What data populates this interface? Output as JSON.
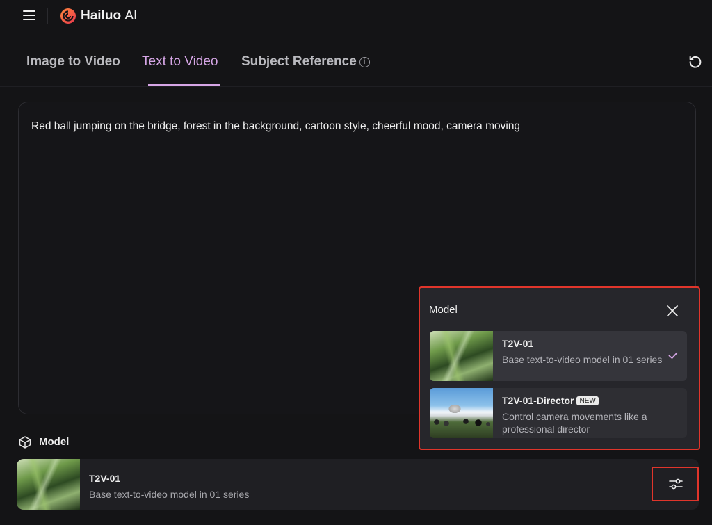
{
  "app": {
    "name": "Hailuo",
    "name_suffix": "AI"
  },
  "icons": {
    "menu": "hamburger-menu-icon",
    "logo": "hailuo-logo-icon",
    "refresh": "refresh-icon",
    "info": "info-icon",
    "model": "cube-icon",
    "settings": "sliders-icon",
    "close": "close-icon",
    "selected": "checkmark-icon"
  },
  "tabs": [
    {
      "label": "Image to Video",
      "active": false
    },
    {
      "label": "Text to Video",
      "active": true
    },
    {
      "label": "Subject Reference",
      "active": false
    }
  ],
  "prompt": {
    "value": "Red ball jumping on the bridge, forest in the background, cartoon style, cheerful mood, camera moving"
  },
  "model_section": {
    "label": "Model",
    "selected": {
      "title": "T2V-01",
      "description": "Base text-to-video model in 01 series"
    }
  },
  "model_popup": {
    "title": "Model",
    "options": [
      {
        "title": "T2V-01",
        "description": "Base text-to-video model in 01 series",
        "selected": true,
        "badge": ""
      },
      {
        "title": "T2V-01-Director",
        "description": "Control camera movements like a professional director",
        "selected": false,
        "badge": "NEW"
      }
    ]
  },
  "colors": {
    "accent": "#d6a6e6",
    "highlight_border": "#e0352b",
    "background": "#141416"
  }
}
